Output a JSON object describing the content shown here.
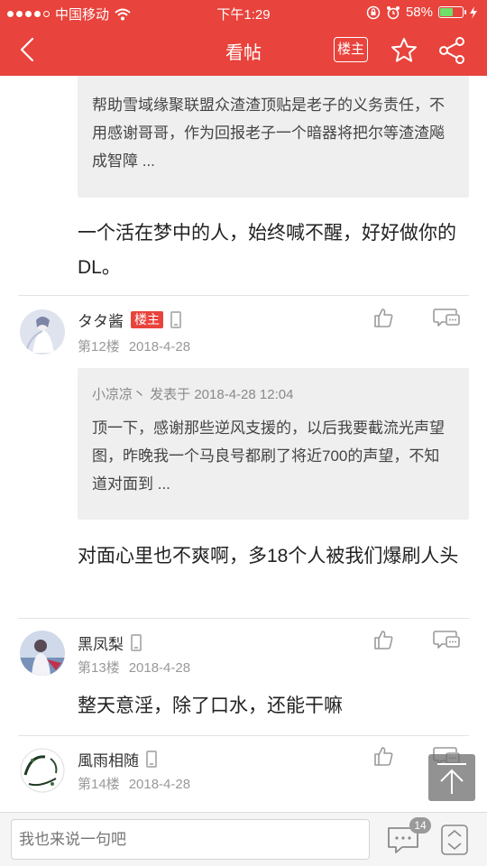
{
  "status_bar": {
    "carrier": "中国移动",
    "time": "下午1:29",
    "battery_percent": "58%",
    "battery_level": 0.58
  },
  "nav": {
    "title": "看帖",
    "owner_label": "楼主"
  },
  "post_top": {
    "quote_text": "帮助雪域缘聚联盟众渣渣顶贴是老子的义务责任，不用感谢哥哥，作为回报老子一个暗器将把尔等渣渣飚成智障 ...",
    "reply_text": "一个活在梦中的人，始终喊不醒，好好做你的DL。"
  },
  "posts": [
    {
      "username": "タタ酱",
      "owner_badge": "楼主",
      "floor": "第12楼",
      "date": "2018-4-28",
      "quote_meta": "小凉凉丶  发表于 2018-4-28 12:04",
      "quote_text": "顶一下，感谢那些逆风支援的，以后我要截流光声望图，昨晚我一个马良号都刷了将近700的声望，不知道对面到 ...",
      "reply_text": "对面心里也不爽啊，多18个人被我们爆刷人头"
    },
    {
      "username": "黑凤梨",
      "floor": "第13楼",
      "date": "2018-4-28",
      "reply_text": "整天意淫，除了口水，还能干嘛"
    },
    {
      "username": "風雨相随",
      "floor": "第14楼",
      "date": "2018-4-28",
      "avatar_text": "風雨相随"
    }
  ],
  "bottom_bar": {
    "input_placeholder": "我也来说一句吧",
    "comment_count": "14"
  },
  "colors": {
    "brand": "#e8433c",
    "quote_bg": "#efefef"
  }
}
